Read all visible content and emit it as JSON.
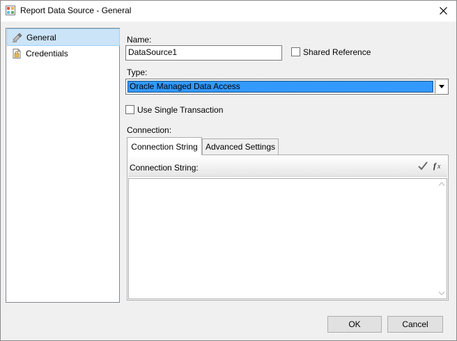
{
  "window": {
    "title": "Report Data Source - General"
  },
  "nav": {
    "items": [
      {
        "label": "General",
        "icon": "general-settings-icon",
        "selected": true
      },
      {
        "label": "Credentials",
        "icon": "credentials-document-icon",
        "selected": false
      }
    ]
  },
  "form": {
    "name_label": "Name:",
    "name_value": "DataSource1",
    "shared_reference_label": "Shared Reference",
    "type_label": "Type:",
    "type_value": "Oracle Managed Data Access",
    "single_transaction_label": "Use Single Transaction",
    "connection_label": "Connection:"
  },
  "tabs": [
    {
      "label": "Connection String",
      "active": true
    },
    {
      "label": "Advanced Settings",
      "active": false
    }
  ],
  "connection_panel": {
    "header_label": "Connection String:",
    "value": "",
    "test_icon": "checkmark-icon",
    "expression_icon": "fx-expression-icon"
  },
  "buttons": {
    "ok_label": "OK",
    "cancel_label": "Cancel"
  },
  "colors": {
    "selection_highlight": "#3399ff",
    "nav_selected": "#cce4f7"
  }
}
